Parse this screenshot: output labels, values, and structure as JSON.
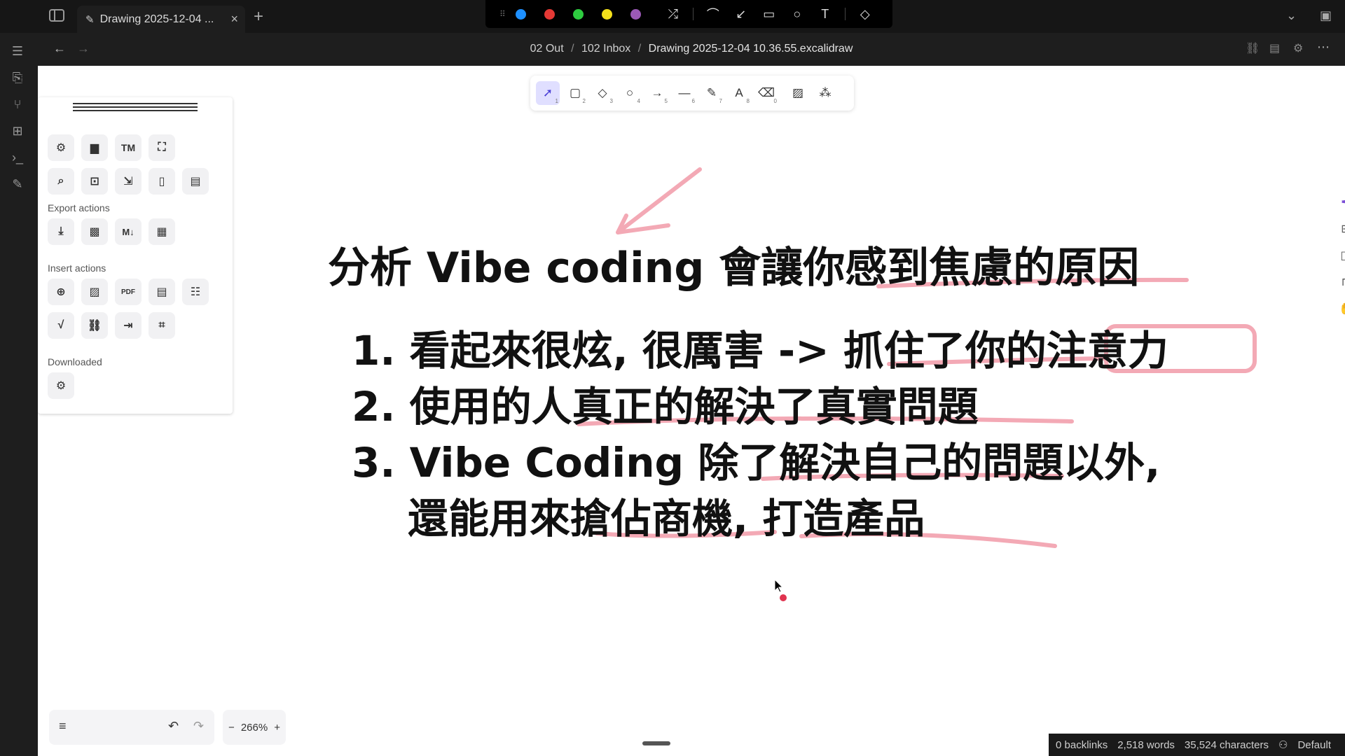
{
  "tab": {
    "title": "Drawing 2025-12-04 ...",
    "close": "×",
    "new": "+"
  },
  "pen_colors": [
    "#1e90ff",
    "#e53935",
    "#2ecc40",
    "#f5e11b",
    "#9b59b6"
  ],
  "pen_tools": [
    "shuffle-icon",
    "freedraw-icon",
    "arrow-icon",
    "rectangle-icon",
    "ellipse-icon",
    "text-icon",
    "eraser-icon"
  ],
  "pen_text": {
    "text_tool": "T"
  },
  "breadcrumb": {
    "part1": "02 Out",
    "part2": "102 Inbox",
    "part3": "Drawing 2025-12-04 10.36.55.excalidraw",
    "sep": "/"
  },
  "toolbar": {
    "tools": [
      {
        "name": "selection",
        "key": "1"
      },
      {
        "name": "rectangle",
        "key": "2"
      },
      {
        "name": "diamond",
        "key": "3"
      },
      {
        "name": "ellipse",
        "key": "4"
      },
      {
        "name": "arrow",
        "key": "5"
      },
      {
        "name": "line",
        "key": "6"
      },
      {
        "name": "draw",
        "key": "7"
      },
      {
        "name": "text",
        "key": "8"
      },
      {
        "name": "eraser",
        "key": "0"
      }
    ]
  },
  "panel": {
    "export_label": "Export actions",
    "insert_label": "Insert actions",
    "downloaded_label": "Downloaded",
    "tm_label": "TM",
    "md_label": "M↓",
    "pdf_label": "PDF"
  },
  "drawing": {
    "title": "分析 Vibe coding 會讓你感到焦慮的原因",
    "item1": "1. 看起來很炫, 很厲害 -> 抓住了你的注意力",
    "item2": "2. 使用的人真正的解決了真實問題",
    "item3a": "3. Vibe Coding 除了解決自己的問題以外,",
    "item3b": "還能用來搶佔商機, 打造產品",
    "accent_color": "#f08fa2"
  },
  "zoom": {
    "level": "266%",
    "minus": "−",
    "plus": "+"
  },
  "status": {
    "backlinks": "0 backlinks",
    "words": "2,518 words",
    "chars": "35,524 characters",
    "mode": "Default"
  }
}
